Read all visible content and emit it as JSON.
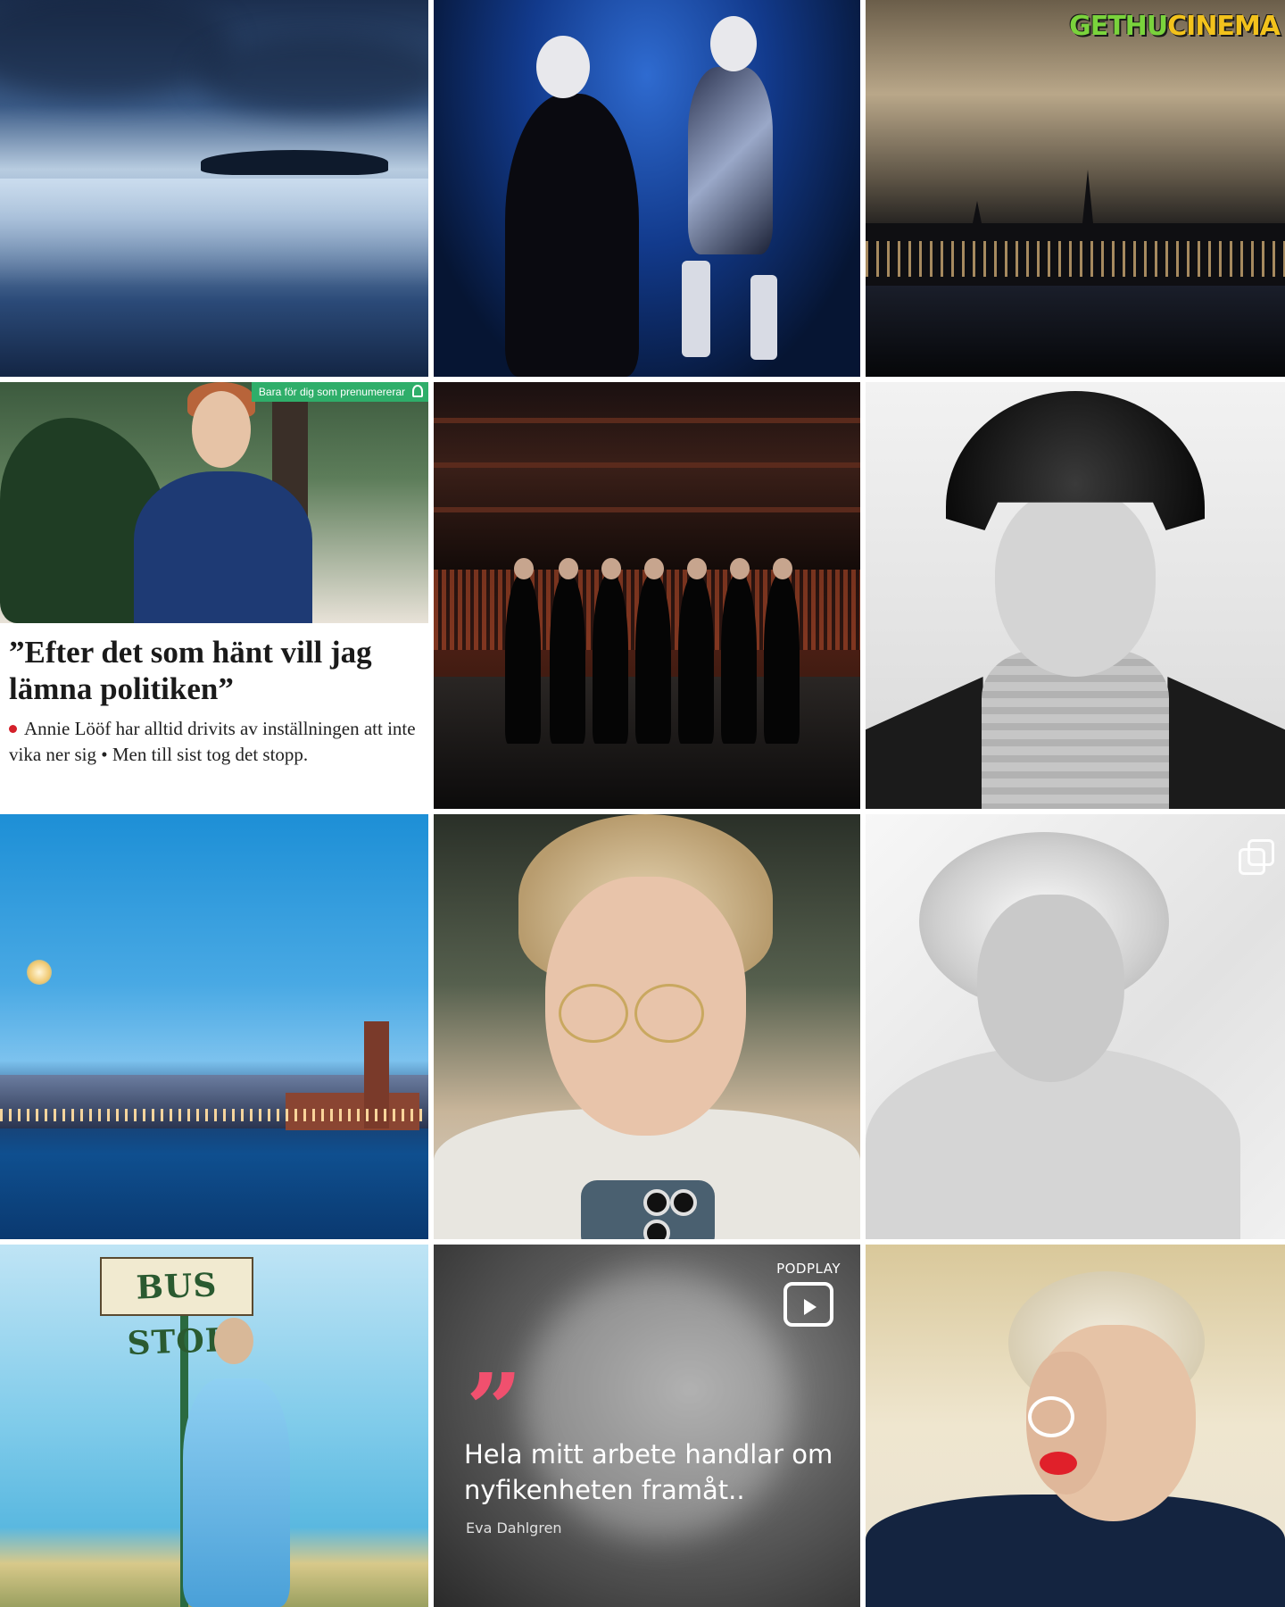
{
  "watermark": {
    "part1": "GETHU",
    "part2": "CINEMA"
  },
  "tiles": [
    {
      "id": "lake",
      "kind": "photo"
    },
    {
      "id": "stage-duo",
      "kind": "photo"
    },
    {
      "id": "night-city",
      "kind": "photo"
    },
    {
      "id": "article",
      "kind": "news-article",
      "badge": "Bara för dig som prenumererar",
      "headline": "”Efter det som hänt vill jag lämna politiken”",
      "dek": "Annie Lööf har alltid drivits av inställningen att inte vika ner sig • Men till sist tog det stopp.",
      "bullet_color": "#d4202a"
    },
    {
      "id": "concert-hall",
      "kind": "photo"
    },
    {
      "id": "fur-hat-portrait",
      "kind": "photo"
    },
    {
      "id": "stockholm-blue",
      "kind": "photo"
    },
    {
      "id": "glasses-portrait",
      "kind": "photo"
    },
    {
      "id": "bw-portrait",
      "kind": "photo",
      "icon": "multiple-images-icon"
    },
    {
      "id": "bus-stop",
      "kind": "photo",
      "sign": "BUS STOP"
    },
    {
      "id": "podplay-quote",
      "kind": "quote-card",
      "brand": "PODPLAY",
      "quote": "Hela mitt arbete handlar om nyfikenheten framåt..",
      "author": "Eva Dahlgren",
      "quote_mark": "”",
      "accent": "#f0506e",
      "icon": "reels-play-icon"
    },
    {
      "id": "laughing-duo",
      "kind": "photo"
    }
  ]
}
